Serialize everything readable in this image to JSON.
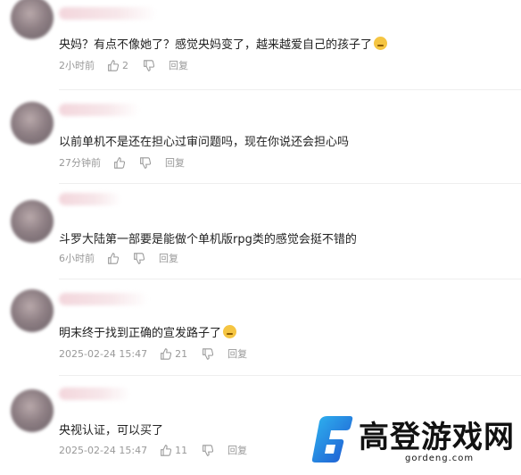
{
  "comments": [
    {
      "text": "央妈？有点不像她了？感觉央妈变了，越来越爱自己的孩子了",
      "time": "2小时前",
      "likes": "2",
      "reply": "回复",
      "emoji": "dog-face-emoji"
    },
    {
      "text": "以前单机不是还在担心过审问题吗，现在你说还会担心吗",
      "time": "27分钟前",
      "likes": "",
      "reply": "回复"
    },
    {
      "text": "斗罗大陆第一部要是能做个单机版rpg类的感觉会挺不错的",
      "time": "6小时前",
      "likes": "",
      "reply": "回复"
    },
    {
      "text": "明末终于找到正确的宣发路子了",
      "time": "2025-02-24 15:47",
      "likes": "21",
      "reply": "回复",
      "emoji": "laughing-face-emoji"
    },
    {
      "text": "央视认证，可以买了",
      "time": "2025-02-24 15:47",
      "likes": "11",
      "reply": "回复"
    }
  ],
  "watermark": {
    "title": "高登游戏网",
    "url": "gordeng.com",
    "accent": "#1e6fd9",
    "accent2": "#2fb6f0"
  }
}
